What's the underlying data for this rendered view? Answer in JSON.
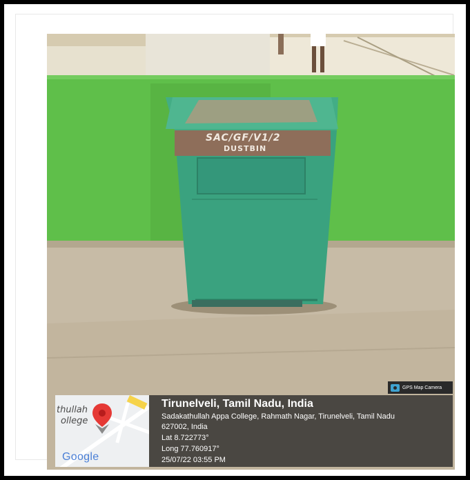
{
  "photo": {
    "bin_label_line1": "SAC/GF/V1/2",
    "bin_label_line2": "DUSTBIN"
  },
  "map": {
    "place_fragment_1": "thullah",
    "place_fragment_2": "ollege",
    "brand": "Google"
  },
  "badge": {
    "label": "GPS Map Camera",
    "icon": "camera-icon"
  },
  "location": {
    "title": "Tirunelveli, Tamil Nadu, India",
    "address_line1": "Sadakathullah Appa College, Rahmath Nagar, Tirunelveli, Tamil Nadu",
    "address_line2": "627002, India",
    "lat": "Lat 8.722773°",
    "long": "Long 77.760917°",
    "timestamp": "25/07/22 03:55 PM"
  },
  "colors": {
    "wall_green": "#5fbf4a",
    "bin_green": "#3aa27f",
    "floor": "#c7bba6",
    "pin_red": "#e53935"
  }
}
